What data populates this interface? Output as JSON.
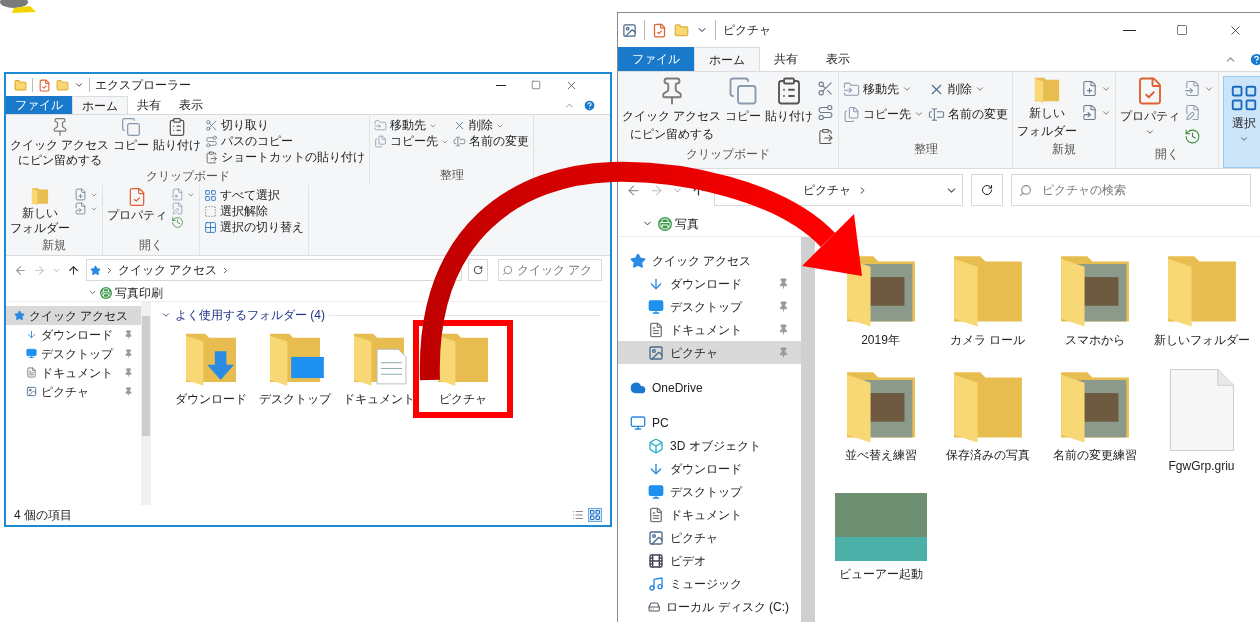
{
  "windows": [
    {
      "kind": "quick_access",
      "title": "エクスプローラー",
      "tabs": [
        {
          "label": "ファイル",
          "kind": "file",
          "selected": false
        },
        {
          "label": "ホーム",
          "kind": "tab",
          "selected": true
        },
        {
          "label": "共有",
          "kind": "tab",
          "selected": false
        },
        {
          "label": "表示",
          "kind": "tab",
          "selected": false
        }
      ],
      "ribbon": [
        {
          "label": "クリップボード",
          "columns": [
            {
              "kind": "pin",
              "lines": [
                "クイック アクセス",
                "にピン留めする"
              ],
              "dropdown": false
            },
            {
              "kind": "copy",
              "lines": [
                "コピー"
              ],
              "dropdown": false
            },
            {
              "kind": "paste",
              "lines": [
                "貼り付け"
              ],
              "dropdown": false
            },
            {
              "kind": "stack",
              "items": [
                {
                  "kind": "cut",
                  "label": "切り取り",
                  "dropdown": false
                },
                {
                  "kind": "copy_path",
                  "label": "パスのコピー",
                  "dropdown": false
                },
                {
                  "kind": "paste_shortcut",
                  "label": "ショートカットの貼り付け",
                  "dropdown": false
                }
              ]
            }
          ]
        },
        {
          "label": "整理",
          "columns": [
            {
              "kind": "stack",
              "items": [
                {
                  "kind": "move_to",
                  "label": "移動先",
                  "dropdown": true
                },
                {
                  "kind": "copy_to",
                  "label": "コピー先",
                  "dropdown": true
                }
              ]
            },
            {
              "kind": "stack",
              "items": [
                {
                  "kind": "delete",
                  "label": "削除",
                  "dropdown": true
                },
                {
                  "kind": "rename",
                  "label": "名前の変更",
                  "dropdown": false
                }
              ]
            }
          ]
        },
        {
          "label": "新規",
          "columns": [
            {
              "kind": "new_folder",
              "lines": [
                "新しい",
                "フォルダー"
              ],
              "dropdown": false
            },
            {
              "kind": "stack",
              "items": [
                {
                  "kind": "new_item",
                  "dropdown": true
                },
                {
                  "kind": "easy_access",
                  "dropdown": true
                }
              ]
            }
          ]
        },
        {
          "label": "開く",
          "columns": [
            {
              "kind": "properties",
              "lines": [
                "プロパティ"
              ],
              "dropdown": false
            },
            {
              "kind": "stack",
              "items": [
                {
                  "kind": "open",
                  "dropdown": true
                },
                {
                  "kind": "edit",
                  "dropdown": false
                },
                {
                  "kind": "history",
                  "dropdown": false
                }
              ]
            }
          ]
        },
        {
          "columns": [
            {
              "kind": "stack",
              "items": [
                {
                  "kind": "select_all",
                  "label": "すべて選択",
                  "dropdown": false
                },
                {
                  "kind": "select_none",
                  "label": "選択解除",
                  "dropdown": false
                },
                {
                  "kind": "invert",
                  "label": "選択の切り替え",
                  "dropdown": false
                }
              ]
            }
          ]
        }
      ],
      "address": {
        "crumbs": [
          "クイック アクセス"
        ]
      },
      "search": {
        "placeholder": "クイック アク"
      },
      "toolbar_label": "写真印刷",
      "nav_tree": [
        {
          "label": "クイック アクセス",
          "kind": "quick",
          "selected": true,
          "children": [
            {
              "label": "ダウンロード",
              "kind": "download",
              "selected": false,
              "pinned": true
            },
            {
              "label": "デスクトップ",
              "kind": "desktop",
              "selected": false,
              "pinned": true
            },
            {
              "label": "ドキュメント",
              "kind": "documents",
              "selected": false,
              "pinned": true
            },
            {
              "label": "ピクチャ",
              "kind": "pictures",
              "selected": false,
              "pinned": true
            }
          ]
        }
      ],
      "content": {
        "header": "よく使用するフォルダー (4)",
        "items": [
          {
            "label": "ダウンロード",
            "kind": "download_folder",
            "highlighted": false
          },
          {
            "label": "デスクトップ",
            "kind": "desktop_folder",
            "highlighted": false
          },
          {
            "label": "ドキュメント",
            "kind": "documents_folder",
            "highlighted": false
          },
          {
            "label": "ピクチャ",
            "kind": "folder",
            "highlighted": true
          }
        ]
      },
      "status": "4 個の項目"
    },
    {
      "kind": "pictures",
      "title": "ピクチャ",
      "tabs": [
        {
          "label": "ファイル",
          "kind": "file",
          "selected": false
        },
        {
          "label": "ホーム",
          "kind": "tab",
          "selected": true
        },
        {
          "label": "共有",
          "kind": "tab",
          "selected": false
        },
        {
          "label": "表示",
          "kind": "tab",
          "selected": false
        }
      ],
      "ribbon": [
        {
          "label": "クリップボード",
          "columns": [
            {
              "kind": "pin",
              "lines": [
                "クイック アクセス",
                "にピン留めする"
              ],
              "dropdown": false
            },
            {
              "kind": "copy",
              "lines": [
                "コピー"
              ],
              "dropdown": false
            },
            {
              "kind": "paste",
              "lines": [
                "貼り付け"
              ],
              "dropdown": false
            },
            {
              "kind": "stack",
              "items": [
                {
                  "kind": "cut",
                  "dropdown": false
                },
                {
                  "kind": "copy_path",
                  "dropdown": false
                },
                {
                  "kind": "paste_shortcut",
                  "dropdown": false
                }
              ]
            }
          ]
        },
        {
          "label": "整理",
          "columns": [
            {
              "kind": "stack",
              "items": [
                {
                  "kind": "move_to",
                  "label": "移動先",
                  "dropdown": true
                },
                {
                  "kind": "copy_to",
                  "label": "コピー先",
                  "dropdown": true
                }
              ]
            },
            {
              "kind": "stack",
              "items": [
                {
                  "kind": "delete",
                  "label": "削除",
                  "dropdown": true
                },
                {
                  "kind": "rename",
                  "label": "名前の変更",
                  "dropdown": false
                }
              ]
            }
          ]
        },
        {
          "label": "新規",
          "columns": [
            {
              "kind": "new_folder",
              "lines": [
                "新しい",
                "フォルダー"
              ],
              "dropdown": false
            },
            {
              "kind": "stack",
              "items": [
                {
                  "kind": "new_item",
                  "dropdown": true
                },
                {
                  "kind": "easy_access",
                  "dropdown": true
                }
              ]
            }
          ]
        },
        {
          "label": "開く",
          "columns": [
            {
              "kind": "properties",
              "lines": [
                "プロパティ"
              ],
              "dropdown": true
            },
            {
              "kind": "stack",
              "items": [
                {
                  "kind": "open",
                  "dropdown": true
                },
                {
                  "kind": "edit",
                  "dropdown": false
                },
                {
                  "kind": "history",
                  "dropdown": false
                }
              ]
            }
          ]
        },
        {
          "columns": [
            {
              "kind": "select",
              "lines": [
                "選択"
              ],
              "dropdown": true,
              "pressed": true
            }
          ]
        }
      ],
      "address": {
        "crumbs": [
          "ピクチャ"
        ]
      },
      "search": {
        "placeholder": "ピクチャの検索"
      },
      "toolbar_label": "写真",
      "nav_tree": [
        {
          "label": "クイック アクセス",
          "kind": "quick",
          "selected": false,
          "children": [
            {
              "label": "ダウンロード",
              "kind": "download",
              "selected": false,
              "pinned": true
            },
            {
              "label": "デスクトップ",
              "kind": "desktop",
              "selected": false,
              "pinned": true
            },
            {
              "label": "ドキュメント",
              "kind": "documents",
              "selected": false,
              "pinned": true
            },
            {
              "label": "ピクチャ",
              "kind": "pictures",
              "selected": true,
              "pinned": true
            }
          ]
        },
        {
          "label": "OneDrive",
          "kind": "onedrive",
          "selected": false
        },
        {
          "label": "PC",
          "kind": "pc",
          "selected": false,
          "children": [
            {
              "label": "3D オブジェクト",
              "kind": "objects3d",
              "selected": false
            },
            {
              "label": "ダウンロード",
              "kind": "download",
              "selected": false
            },
            {
              "label": "デスクトップ",
              "kind": "desktop",
              "selected": false
            },
            {
              "label": "ドキュメント",
              "kind": "documents",
              "selected": false
            },
            {
              "label": "ピクチャ",
              "kind": "pictures",
              "selected": false
            },
            {
              "label": "ビデオ",
              "kind": "videos",
              "selected": false
            },
            {
              "label": "ミュージック",
              "kind": "music",
              "selected": false
            },
            {
              "label": "ローカル ディスク (C:)",
              "kind": "disk",
              "selected": false
            }
          ]
        }
      ],
      "content": {
        "items": [
          {
            "label": "2019年",
            "kind": "photo_folder"
          },
          {
            "label": "カメラ ロール",
            "kind": "folder"
          },
          {
            "label": "スマホから",
            "kind": "photo_folder"
          },
          {
            "label": "新しいフォルダー",
            "kind": "folder"
          },
          {
            "label": "並べ替え練習",
            "kind": "photo_folder"
          },
          {
            "label": "保存済みの写真",
            "kind": "folder"
          },
          {
            "label": "名前の変更練習",
            "kind": "photo_folder"
          },
          {
            "label": "FgwGrp.griu",
            "kind": "file"
          },
          {
            "label": "ビューアー起動",
            "kind": "image"
          }
        ]
      }
    }
  ]
}
